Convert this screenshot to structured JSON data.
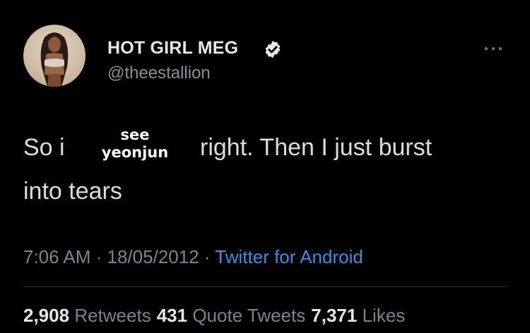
{
  "author": {
    "display_name": "HOT GIRL MEG",
    "handle": "@theestallion",
    "verified_icon": "verified-badge-icon",
    "more_icon": "more-options-icon"
  },
  "tweet": {
    "text_before": "So i",
    "text_after": "right. Then I just burst",
    "text_line2": "into tears",
    "overlay_caption_line1": "see",
    "overlay_caption_line2": "yeonjun"
  },
  "meta": {
    "time": "7:06 AM",
    "separator": " · ",
    "date": "18/05/2012",
    "source": "Twitter for Android"
  },
  "stats": {
    "retweets_count": "2,908",
    "retweets_label": "Retweets",
    "quotes_count": "431",
    "quotes_label": "Quote Tweets",
    "likes_count": "7,371",
    "likes_label": "Likes"
  },
  "colors": {
    "background": "#000000",
    "link": "#2e93e0",
    "muted": "#7e8388"
  }
}
